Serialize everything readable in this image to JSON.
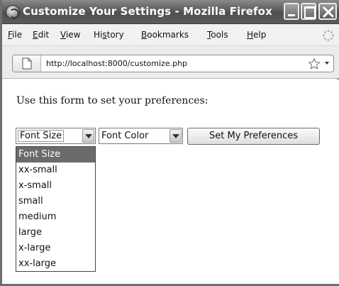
{
  "window": {
    "title": "Customize Your Settings - Mozilla Firefox"
  },
  "menubar": {
    "items": [
      {
        "access": "F",
        "rest": "ile"
      },
      {
        "access": "E",
        "rest": "dit"
      },
      {
        "access": "V",
        "rest": "iew"
      },
      {
        "pre": "Hi",
        "access": "s",
        "rest": "tory"
      },
      {
        "access": "B",
        "rest": "ookmarks"
      },
      {
        "access": "T",
        "rest": "ools"
      },
      {
        "access": "H",
        "rest": "elp"
      }
    ]
  },
  "navbar": {
    "url": "http://localhost:8000/customize.php"
  },
  "page": {
    "intro": "Use this form to set your preferences:",
    "font_size_select": {
      "selected": "Font Size",
      "options": [
        "Font Size",
        "xx-small",
        "x-small",
        "small",
        "medium",
        "large",
        "x-large",
        "xx-large"
      ]
    },
    "font_color_select": {
      "selected": "Font Color"
    },
    "submit_label": "Set My Preferences"
  }
}
